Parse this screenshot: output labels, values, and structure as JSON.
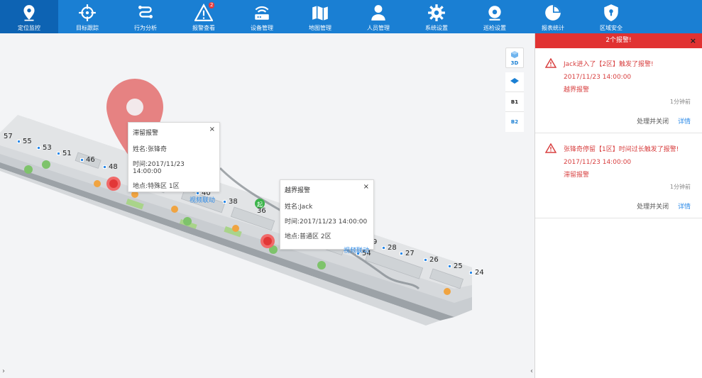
{
  "nav": {
    "items": [
      {
        "label": "定位监控",
        "icon": "location-pin-icon",
        "active": true
      },
      {
        "label": "目标跟踪",
        "icon": "crosshair-icon"
      },
      {
        "label": "行为分析",
        "icon": "route-icon"
      },
      {
        "label": "报警查看",
        "icon": "warning-icon",
        "badge": "2"
      },
      {
        "label": "设备管理",
        "icon": "router-icon"
      },
      {
        "label": "地图管理",
        "icon": "map-icon"
      },
      {
        "label": "人员管理",
        "icon": "user-icon"
      },
      {
        "label": "系统设置",
        "icon": "gear-icon"
      },
      {
        "label": "巡检设置",
        "icon": "patrol-icon"
      },
      {
        "label": "报表统计",
        "icon": "pie-chart-icon"
      },
      {
        "label": "区域安全",
        "icon": "shield-icon"
      }
    ]
  },
  "map": {
    "markers": [
      "57",
      "55",
      "53",
      "51",
      "46",
      "48",
      "40",
      "38",
      "36",
      "9",
      "28",
      "27",
      "26",
      "25",
      "24",
      "54"
    ],
    "tools": {
      "three_d": "3D",
      "floor_b1": "B1",
      "floor_b2": "B2"
    },
    "popup1": {
      "title": "滞留报警",
      "name": "姓名:张锋奇",
      "time": "时间:2017/11/23 14:00:00",
      "location": "地点:特殊区 1区",
      "link": "视频联动",
      "close": "×"
    },
    "popup2": {
      "title": "越界报警",
      "name": "姓名:Jack",
      "time": "时间:2017/11/23 14:00:00",
      "location": "地点:普通区 2区",
      "link": "视频联动",
      "close": "×"
    },
    "start_marker": "起"
  },
  "alarm_panel": {
    "title": "2个报警!",
    "close": "×",
    "items": [
      {
        "message": "Jack进入了【2区】触发了报警!",
        "time": "2017/11/23 14:00:00",
        "type": "越界报警",
        "ago": "1分钟前",
        "action_close": "处理并关闭",
        "action_detail": "详情"
      },
      {
        "message": "张锋奇停留【1区】时间过长触发了报警!",
        "time": "2017/11/23 14:00:00",
        "type": "滞留报警",
        "ago": "1分钟前",
        "action_close": "处理并关闭",
        "action_detail": "详情"
      }
    ]
  },
  "colors": {
    "nav_bg": "#1a7fd3",
    "nav_active": "#0d63b3",
    "alarm_red": "#e13232",
    "link_blue": "#2e8be8"
  }
}
